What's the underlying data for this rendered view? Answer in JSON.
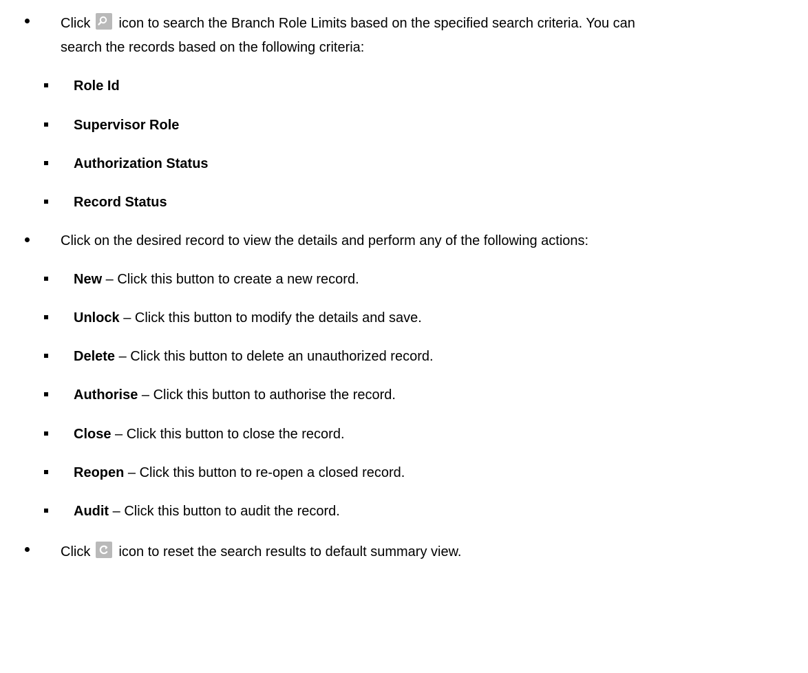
{
  "items": [
    {
      "before_icon": "Click",
      "icon": "search-icon",
      "after_icon": "icon to search the Branch Role Limits based on the specified search criteria. You can",
      "continuation": "search the records based on the following criteria:",
      "subitems": [
        {
          "term": "Role Id",
          "desc": ""
        },
        {
          "term": "Supervisor Role",
          "desc": ""
        },
        {
          "term": "Authorization Status",
          "desc": ""
        },
        {
          "term": "Record Status",
          "desc": ""
        }
      ]
    },
    {
      "text": "Click on the desired record to view the details and perform any of the following actions:",
      "subitems": [
        {
          "term": "New",
          "desc": " – Click this button to create a new record."
        },
        {
          "term": "Unlock",
          "desc": " – Click this button to modify the details and save."
        },
        {
          "term": "Delete",
          "desc": " – Click this button to delete an unauthorized record."
        },
        {
          "term": "Authorise",
          "desc": " – Click this button to authorise the record."
        },
        {
          "term": "Close",
          "desc": " – Click this button to close the record."
        },
        {
          "term": "Reopen",
          "desc": " – Click this button to re-open a closed record."
        },
        {
          "term": "Audit",
          "desc": " – Click this button to audit the record."
        }
      ]
    },
    {
      "before_icon": "Click",
      "icon": "reset-icon",
      "after_icon": "icon to reset the search results to default summary view."
    }
  ]
}
